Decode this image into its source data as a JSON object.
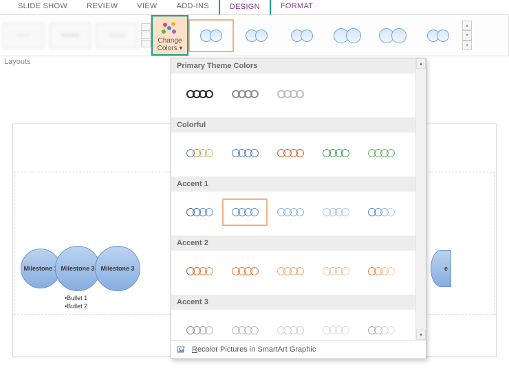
{
  "tabs": {
    "slideshow": "SLIDE SHOW",
    "review": "REVIEW",
    "view": "VIEW",
    "addins": "ADD-INS",
    "design": "DESIGN",
    "format": "FORMAT"
  },
  "ribbon": {
    "layouts_group": "Layouts",
    "change_colors": {
      "line1": "Change",
      "line2": "Colors ▾"
    }
  },
  "slide": {
    "milestones": [
      "Milestone 1",
      "Milestone 3",
      "Milestone 3"
    ],
    "trailing_char": "e",
    "bullets": [
      "•Bullet 1",
      "•Bullet 2"
    ]
  },
  "dropdown": {
    "sections": {
      "primary": "Primary Theme Colors",
      "colorful": "Colorful",
      "accent1": "Accent 1",
      "accent2": "Accent 2",
      "accent3": "Accent 3"
    },
    "footer": {
      "label_prefix": "R",
      "label_rest": "ecolor Pictures in SmartArt Graphic"
    }
  },
  "color_rows": {
    "primary": [
      [
        "#2b2b2b",
        "#2b2b2b",
        "#2b2b2b",
        "#2b2b2b"
      ],
      [
        "#8e8e8e",
        "#8e8e8e",
        "#8e8e8e",
        "#8e8e8e"
      ],
      [
        "#bdbdbd",
        "#bdbdbd",
        "#bdbdbd",
        "#bdbdbd"
      ]
    ],
    "colorful": [
      [
        "#4e80c3",
        "#d98b2b",
        "#b7b7b7",
        "#e8b93e"
      ],
      [
        "#4e80c3",
        "#4e80c3",
        "#4e80c3",
        "#4e80c3"
      ],
      [
        "#d06a28",
        "#d06a28",
        "#d06a28",
        "#d06a28"
      ],
      [
        "#47a35a",
        "#47a35a",
        "#47a35a",
        "#47a35a"
      ],
      [
        "#6aaf6a",
        "#6aaf6a",
        "#6aaf6a",
        "#6aaf6a"
      ]
    ],
    "accent1": [
      [
        "#2f5fa1",
        "#3f72b8",
        "#5388ce",
        "#6a9bdd"
      ],
      [
        "#5e8fd0",
        "#5e8fd0",
        "#5e8fd0",
        "#5e8fd0"
      ],
      [
        "#8cb3e2",
        "#8cb3e2",
        "#8cb3e2",
        "#8cb3e2"
      ],
      [
        "#a9c7ec",
        "#a9c7ec",
        "#a9c7ec",
        "#a9c7ec"
      ],
      [
        "#4e7fbe",
        "#6998d3",
        "#8cb3e2",
        "#b6d0ee"
      ]
    ],
    "accent2": [
      [
        "#c0612a",
        "#d07235",
        "#df8342",
        "#ea9554"
      ],
      [
        "#e57f3e",
        "#e57f3e",
        "#e57f3e",
        "#e57f3e"
      ],
      [
        "#f0a66f",
        "#f0a66f",
        "#f0a66f",
        "#f0a66f"
      ],
      [
        "#f5c39b",
        "#f5c39b",
        "#f5c39b",
        "#f5c39b"
      ],
      [
        "#dd8142",
        "#ea9d64",
        "#f3bb8f",
        "#f8d4b6"
      ]
    ],
    "accent3": [
      [
        "#8b8b8b",
        "#9a9a9a",
        "#aaaaaa",
        "#bcbcbc"
      ],
      [
        "#bcbcbc",
        "#bcbcbc",
        "#bcbcbc",
        "#bcbcbc"
      ],
      [
        "#d2d2d2",
        "#d2d2d2",
        "#d2d2d2",
        "#d2d2d2"
      ],
      [
        "#dedede",
        "#dedede",
        "#dedede",
        "#dedede"
      ],
      [
        "#a6a6a6",
        "#bdbdbd",
        "#d2d2d2",
        "#e3e3e3"
      ]
    ]
  }
}
